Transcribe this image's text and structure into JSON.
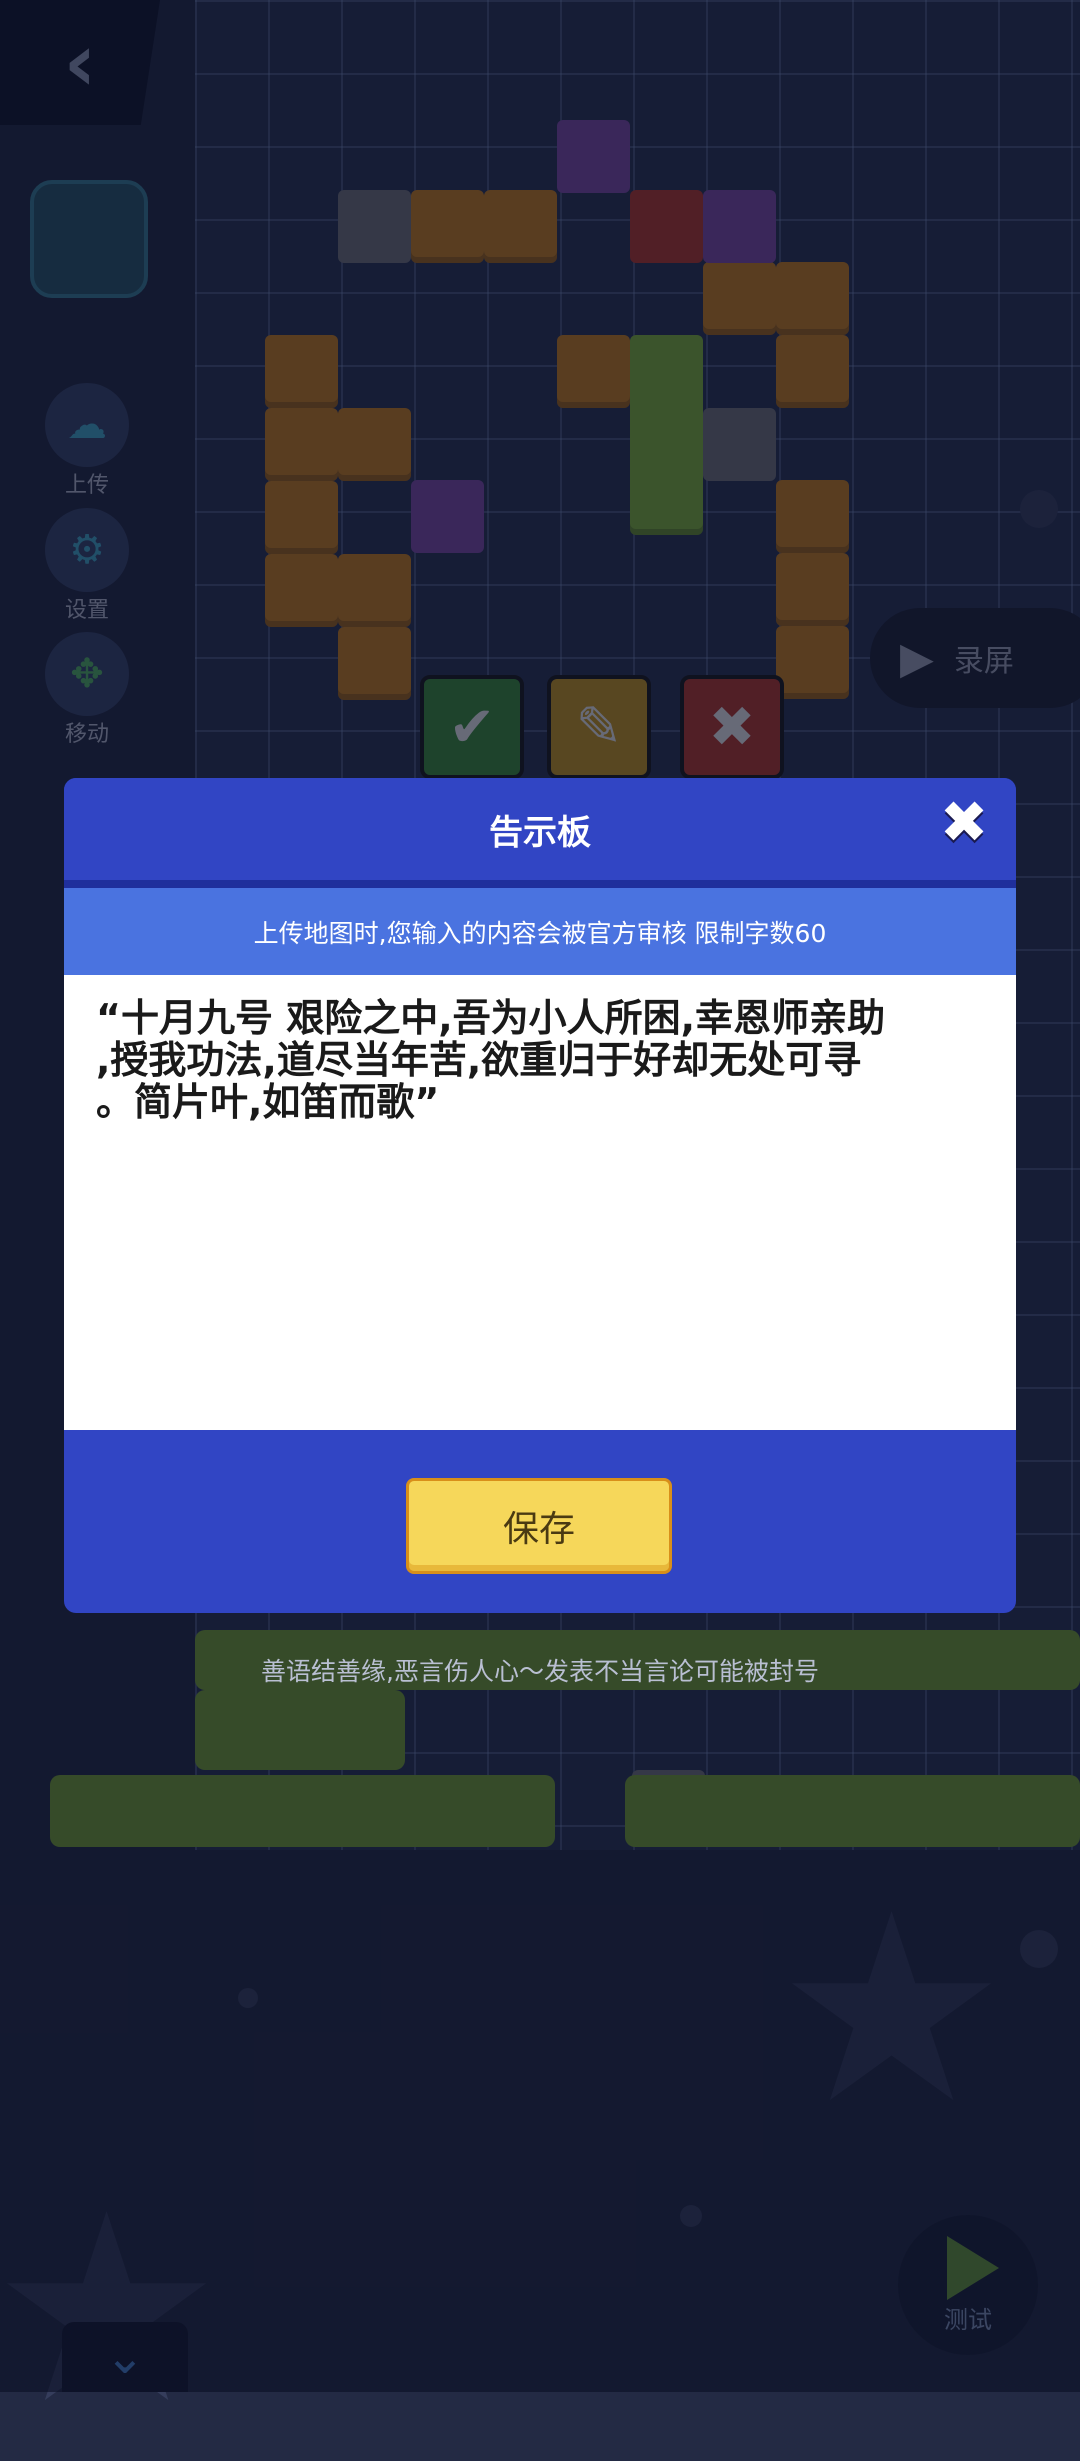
{
  "toolbar": {
    "back_icon": "‹",
    "upload_label": "上传",
    "settings_label": "设置",
    "move_label": "移动"
  },
  "record": {
    "label": "录屏"
  },
  "actions": {
    "confirm_icon": "✔",
    "edit_icon": "✎",
    "cancel_icon": "✖"
  },
  "dialog": {
    "title": "告示板",
    "close_icon": "✖",
    "notice": "上传地图时,您输入的内容会被官方审核 限制字数60",
    "content": "“十月九号 艰险之中,吾为小人所困,幸恩师亲助\n,授我功法,道尽当年苦,欲重归于好却无处可寻\n。简片叶,如笛而歌”",
    "save_label": "保存"
  },
  "warning": "善语结善缘,恶言伤人心～发表不当言论可能被封号",
  "bottom": {
    "test_label": "测试",
    "collapse_icon": "⌄"
  },
  "colors": {
    "dialog_bg": "#3145c4",
    "notice_bg": "#4a73e0",
    "save_button": "#f6d75a"
  }
}
